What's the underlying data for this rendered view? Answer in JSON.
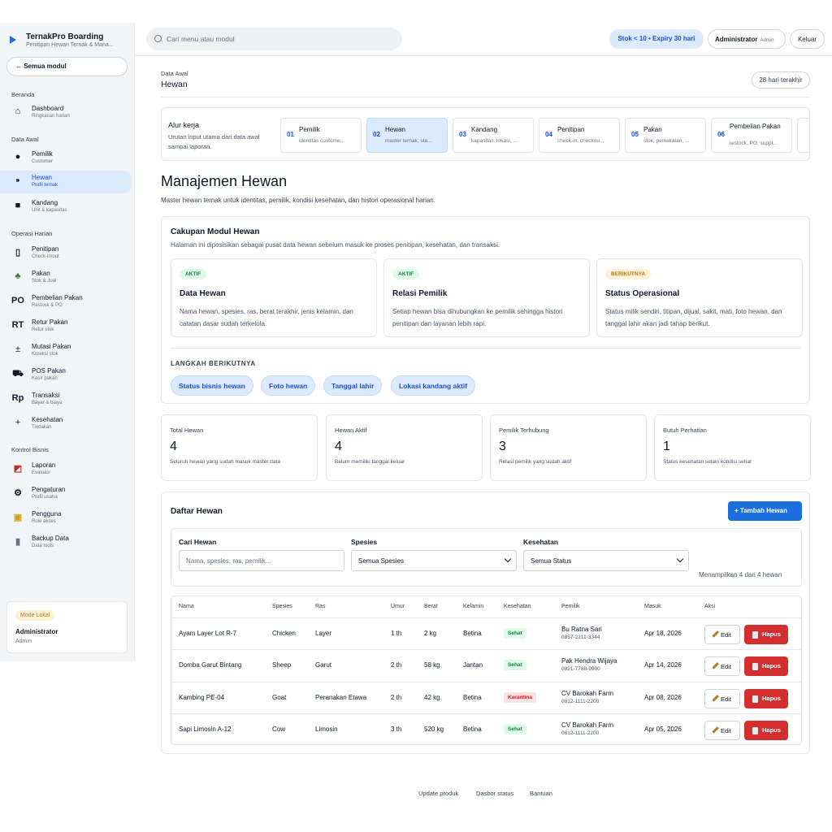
{
  "sidebar": {
    "brand_title": "TernakPro Boarding",
    "brand_sub": "Penitipan Hewan Ternak & Mana...",
    "all_modules": "← Semua modul",
    "sections": [
      "Beranda",
      "Data Awal",
      "Operasi Harian",
      "Kontrol Bisnis"
    ],
    "items": [
      {
        "label": "Dashboard",
        "sub": "Ringkasan harian",
        "icon": "home-icon"
      },
      {
        "label": "Pemilik",
        "sub": "Customer",
        "icon": "user-icon"
      },
      {
        "label": "Hewan",
        "sub": "Profil ternak",
        "icon": "paw-icon"
      },
      {
        "label": "Kandang",
        "sub": "Unit & kapasitas",
        "icon": "square-icon"
      },
      {
        "label": "Penitipan",
        "sub": "Check-in/out",
        "icon": "clipboard-icon"
      },
      {
        "label": "Pakan",
        "sub": "Stok & Jual",
        "icon": "leaf-icon"
      },
      {
        "label": "Pembelian Pakan",
        "sub": "Restock & PO",
        "icon": "po-icon"
      },
      {
        "label": "Retur Pakan",
        "sub": "Retur stok",
        "icon": "rt-icon"
      },
      {
        "label": "Mutasi Pakan",
        "sub": "Koreksi stok",
        "icon": "plus-minus-icon"
      },
      {
        "label": "POS Pakan",
        "sub": "Kasir pakan",
        "icon": "cart-icon"
      },
      {
        "label": "Transaksi",
        "sub": "Bayar & biaya",
        "icon": "rp-icon"
      },
      {
        "label": "Kesehatan",
        "sub": "Tindakan",
        "icon": "plus-icon"
      },
      {
        "label": "Laporan",
        "sub": "Evaluasi",
        "icon": "chart-icon"
      },
      {
        "label": "Pengaturan",
        "sub": "Profil usaha",
        "icon": "gear-icon"
      },
      {
        "label": "Pengguna",
        "sub": "Role akses",
        "icon": "lock-icon"
      },
      {
        "label": "Backup Data",
        "sub": "Data tools",
        "icon": "database-icon"
      }
    ],
    "mode_badge": "Mode Lokal",
    "mode_user": "Administrator",
    "mode_role": "Admin"
  },
  "topbar": {
    "search_placeholder": "Cari menu atau modul",
    "stock_pill": "Stok < 10 • Expiry 30 hari",
    "user_name": "Administrator",
    "user_role": "Admin",
    "logout": "Keluar"
  },
  "header": {
    "breadcrumb_parent": "Data Awal",
    "breadcrumb_current": "Hewan",
    "range": "28 hari terakhir"
  },
  "workflow": {
    "title": "Alur kerja",
    "desc": "Urutan input utama dari data awal sampai laporan.",
    "steps": [
      {
        "num": "01",
        "title": "Pemilik",
        "desc": "identitas custome..."
      },
      {
        "num": "02",
        "title": "Hewan",
        "desc": "master ternak, sta..."
      },
      {
        "num": "03",
        "title": "Kandang",
        "desc": "kapasitas, lokasi, ..."
      },
      {
        "num": "04",
        "title": "Penitipan",
        "desc": "check-in, checkou..."
      },
      {
        "num": "05",
        "title": "Pakan",
        "desc": "stok, pemakaian, ..."
      },
      {
        "num": "06",
        "title": "Pembelian Pakan",
        "desc": "restock, PO, suppl..."
      }
    ]
  },
  "page": {
    "title": "Manajemen Hewan",
    "subtitle": "Master hewan ternak untuk identitas, pemilik, kondisi kesehatan, dan histori operasional harian."
  },
  "scope": {
    "title": "Cakupan Modul Hewan",
    "subtitle": "Halaman ini diposisikan sebagai pusat data hewan sebelum masuk ke proses penitipan, kesehatan, dan transaksi.",
    "cards": [
      {
        "badge": "AKTIF",
        "title": "Data Hewan",
        "desc": "Nama hewan, spesies, ras, berat terakhir, jenis kelamin, dan catatan dasar sudah terkelola."
      },
      {
        "badge": "AKTIF",
        "title": "Relasi Pemilik",
        "desc": "Setiap hewan bisa dihubungkan ke pemilik sehingga histori penitipan dan layanan lebih rapi."
      },
      {
        "badge": "BERIKUTNYA",
        "title": "Status Operasional",
        "desc": "Status milik sendiri, titipan, dijual, sakit, mati, foto hewan, dan tanggal lahir akan jadi tahap berikut."
      }
    ],
    "next_label": "LANGKAH BERIKUTNYA",
    "next_chips": [
      "Status bisnis hewan",
      "Foto hewan",
      "Tanggal lahir",
      "Lokasi kandang aktif"
    ]
  },
  "stats": [
    {
      "label": "Total Hewan",
      "value": "4",
      "desc": "Seluruh hewan yang sudah masuk master data"
    },
    {
      "label": "Hewan Aktif",
      "value": "4",
      "desc": "Belum memiliki tanggal keluar"
    },
    {
      "label": "Pemilik Terhubung",
      "value": "3",
      "desc": "Relasi pemilik yang sudah aktif"
    },
    {
      "label": "Butuh Perhatian",
      "value": "1",
      "desc": "Status kesehatan selain kondisi sehat"
    }
  ],
  "list": {
    "title": "Daftar Hewan",
    "add_button": "Tambah Hewan",
    "filter_search_label": "Cari Hewan",
    "filter_search_placeholder": "Nama, spesies, ras, pemilik...",
    "filter_species_label": "Spesies",
    "filter_species_value": "Semua Spesies",
    "filter_health_label": "Kesehatan",
    "filter_health_value": "Semua Status",
    "count_text": "Menampilkan 4 dari 4 hewan",
    "columns": [
      "Nama",
      "Spesies",
      "Ras",
      "Umur",
      "Berat",
      "Kelamin",
      "Kesehatan",
      "Pemilik",
      "Masuk",
      "Aksi"
    ],
    "edit_label": "Edit",
    "delete_label": "Hapus",
    "rows": [
      {
        "name": "Ayam Layer Lot R-7",
        "species": "Chicken",
        "breed": "Layer",
        "age": "1 th",
        "weight": "2 kg",
        "sex": "Betina",
        "health": "Sehat",
        "owner": "Bu Ratna Sari",
        "phone": "0857-2211-3344",
        "date": "Apr 18, 2026"
      },
      {
        "name": "Domba Garut Bintang",
        "species": "Sheep",
        "breed": "Garut",
        "age": "2 th",
        "weight": "58 kg",
        "sex": "Jantan",
        "health": "Sehat",
        "owner": "Pak Hendra Wijaya",
        "phone": "0821-7788-9900",
        "date": "Apr 14, 2026"
      },
      {
        "name": "Kambing PE-04",
        "species": "Goat",
        "breed": "Peranakan Etawa",
        "age": "2 th",
        "weight": "42 kg",
        "sex": "Betina",
        "health": "Karantina",
        "owner": "CV Barokah Farm",
        "phone": "0812-1111-2200",
        "date": "Apr 08, 2026"
      },
      {
        "name": "Sapi Limosin A-12",
        "species": "Cow",
        "breed": "Limosin",
        "age": "3 th",
        "weight": "520 kg",
        "sex": "Betina",
        "health": "Sehat",
        "owner": "CV Barokah Farm",
        "phone": "0812-1111-2200",
        "date": "Apr 05, 2026"
      }
    ]
  },
  "footer": {
    "links": [
      "Update produk",
      "Dasbor status",
      "Bantuan"
    ]
  }
}
